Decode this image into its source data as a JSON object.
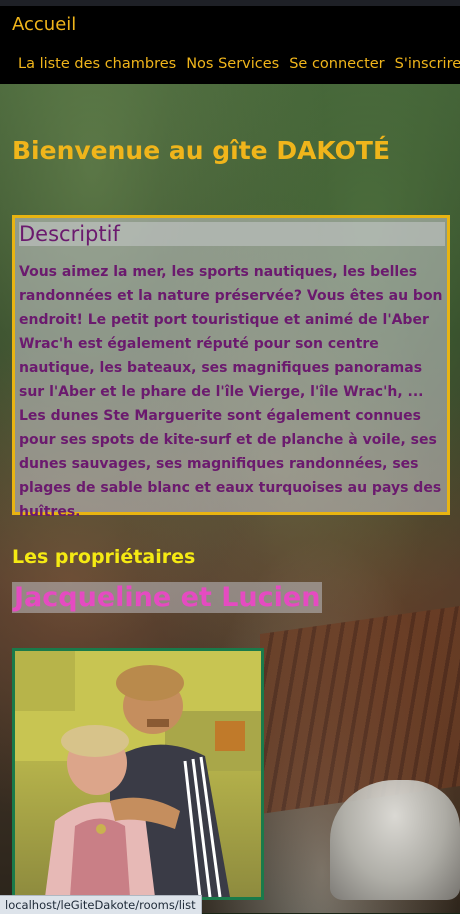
{
  "navbar": {
    "brand": "Accueil",
    "links": [
      {
        "label": "La liste des chambres"
      },
      {
        "label": "Nos Services"
      },
      {
        "label": "Se connecter"
      },
      {
        "label": "S'inscrire"
      }
    ]
  },
  "main": {
    "welcome_title": "Bienvenue au gîte DAKOTÉ",
    "description": {
      "title": "Descriptif",
      "text": "Vous aimez la mer, les sports nautiques, les belles randonnées et la nature préservée? Vous êtes au bon endroit! Le petit port touristique et animé de l'Aber Wrac'h est également réputé pour son centre nautique, les bateaux, ses magnifiques panoramas sur l'Aber et le phare de l'île Vierge, l'île Wrac'h, ... Les dunes Ste Marguerite sont également connues pour ses spots de kite-surf et de planche à voile, ses dunes sauvages, ses magnifiques randonnées, ses plages de sable blanc et eaux turquoises au pays des huîtres."
    },
    "owners": {
      "heading": "Les propriétaires",
      "names": "Jacqueline et Lucien"
    }
  },
  "status_bar": {
    "url": "localhost/leGiteDakote/rooms/list"
  },
  "colors": {
    "accent": "#f0b51b",
    "description_text": "#6b1a6e",
    "owners_heading": "#f5ea13",
    "owners_names": "#e54bc1",
    "desc_border": "#e8b412",
    "photo_border": "#1a7a4a"
  }
}
